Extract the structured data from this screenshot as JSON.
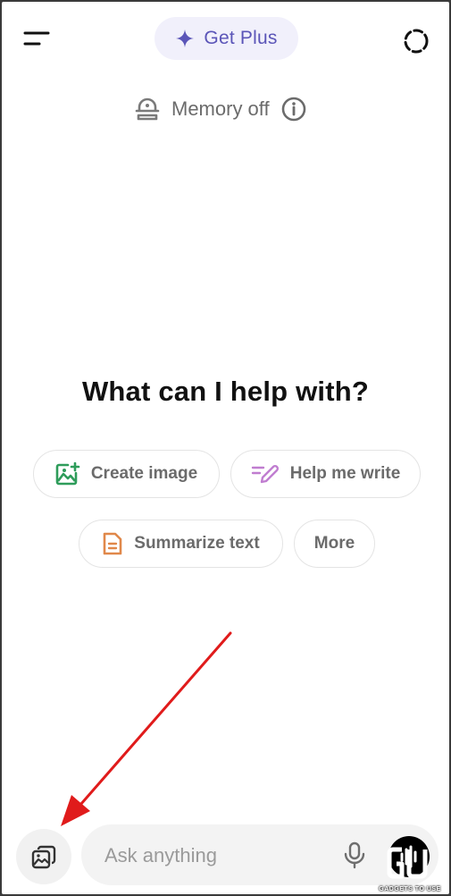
{
  "header": {
    "get_plus_label": "Get Plus",
    "menu_icon": "menu-icon",
    "plus_icon": "sparkle-icon",
    "temp_chat_icon": "dashed-circle-icon",
    "accent_color": "#5b55b8"
  },
  "memory": {
    "label": "Memory off",
    "icon": "memory-off-icon",
    "info_icon": "info-icon"
  },
  "main": {
    "heading": "What can I help with?"
  },
  "suggestions": [
    {
      "label": "Create image",
      "icon": "image-plus-icon",
      "color": "#2e9c5a"
    },
    {
      "label": "Help me write",
      "icon": "pen-icon",
      "color": "#c07dd0"
    },
    {
      "label": "Summarize text",
      "icon": "document-icon",
      "color": "#e0884a"
    },
    {
      "label": "More"
    }
  ],
  "composer": {
    "placeholder": "Ask anything",
    "attach_icon": "photos-icon",
    "mic_icon": "microphone-icon",
    "voice_icon": "voice-waveform-icon"
  },
  "annotation": {
    "arrow_color": "#e01b1b"
  },
  "watermark": {
    "text": "GADGETS TO USE"
  }
}
